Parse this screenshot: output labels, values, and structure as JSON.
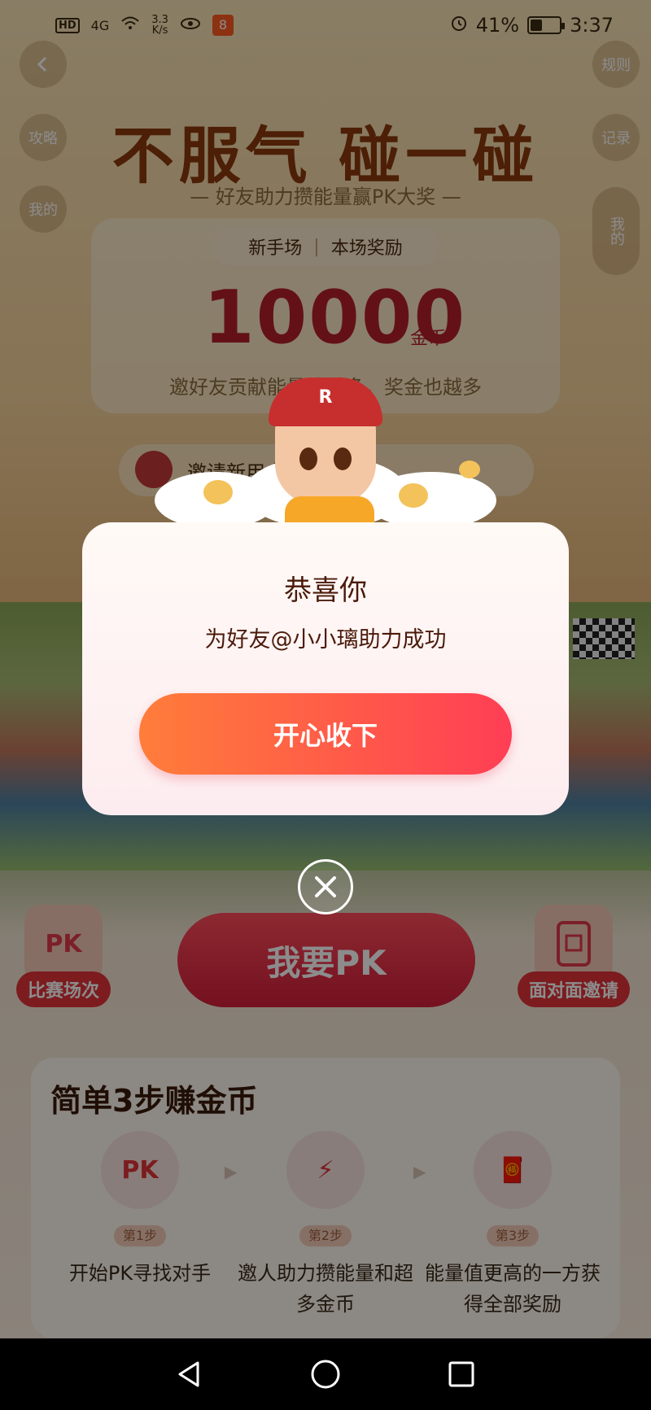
{
  "status_bar": {
    "hd": "HD",
    "network": "4G",
    "speed": "3.3\nK/s",
    "app_badge": "8",
    "battery_text": "41%",
    "battery_level": 0.41,
    "time": "3:37"
  },
  "top_buttons": {
    "back_icon": "chevron-left-icon",
    "rules": "规则",
    "guide": "攻略",
    "record": "记录",
    "my_list": "我的",
    "side_tab": "我的"
  },
  "hero": {
    "title": "不服气 碰一碰",
    "subtitle": "— 好友助力攒能量赢PK大奖 —"
  },
  "reward": {
    "tab_left": "新手场",
    "tab_sep": "|",
    "tab_right": "本场奖励",
    "amount": "10000",
    "unit": "金币",
    "description": "邀好友贡献能量值越多，奖金也越多"
  },
  "invite": {
    "text": "邀请新用户 打败对方"
  },
  "mascot": {
    "cap_letter": "R"
  },
  "actions": {
    "pk_button": "我要PK",
    "left_feature_icon": "PK",
    "left_feature_label": "比赛场次",
    "right_feature_label": "面对面邀请"
  },
  "steps": {
    "title": "简单3步赚金币",
    "items": [
      {
        "icon": "PK",
        "num": "第1步",
        "text": "开始PK寻找对手"
      },
      {
        "icon": "⚡",
        "num": "第2步",
        "text": "邀人助力攒能量和超多金币"
      },
      {
        "icon": "🧧",
        "num": "第3步",
        "text": "能量值更高的一方获得全部奖励"
      }
    ]
  },
  "dialog": {
    "title": "恭喜你",
    "message": "为好友@小小璃助力成功",
    "confirm": "开心收下"
  },
  "close_icon": "close-circle-icon",
  "navbar": {
    "back": "back-triangle-icon",
    "home": "home-circle-icon",
    "recent": "recent-square-icon"
  }
}
